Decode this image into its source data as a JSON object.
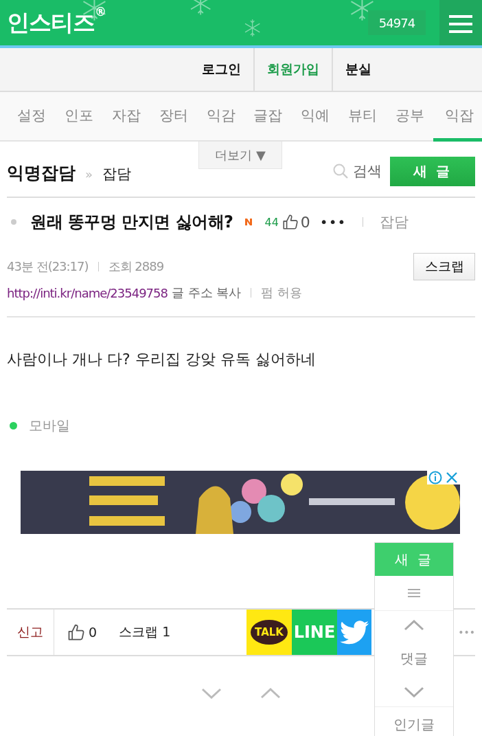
{
  "header": {
    "logo": "인스티즈",
    "logo_mark": "®",
    "counter": "54974"
  },
  "account_links": [
    {
      "label": "로그인",
      "highlighted": false
    },
    {
      "label": "회원가입",
      "highlighted": true
    },
    {
      "label": "분실",
      "highlighted": false
    }
  ],
  "category_tabs": [
    {
      "label": "설정",
      "selected": false
    },
    {
      "label": "인포",
      "selected": false
    },
    {
      "label": "자잡",
      "selected": false
    },
    {
      "label": "장터",
      "selected": false
    },
    {
      "label": "익감",
      "selected": false
    },
    {
      "label": "글잡",
      "selected": false
    },
    {
      "label": "익예",
      "selected": false
    },
    {
      "label": "뷰티",
      "selected": false
    },
    {
      "label": "공부",
      "selected": false
    },
    {
      "label": "익잡",
      "selected": true
    }
  ],
  "board": {
    "title": "익명잡담",
    "separator": "»",
    "subcategory": "잡담",
    "more_label": "더보기",
    "more_arrow": "▼",
    "search_label": "검색",
    "new_post_button": "새 글"
  },
  "post": {
    "title": "원래 똥꾸멍 만지면 싫어해?",
    "comment_count": "44",
    "likes": "0",
    "menu": "•••",
    "category": "잡담",
    "time": "43분 전(23:17)",
    "views": "조회 2889",
    "scrap_button": "스크랩",
    "url": "http://inti.kr/name/23549758",
    "copy_link": "글 주소 복사",
    "permission": "펌 허용",
    "body": "사람이나 개나 다? 우리집 강앚 유독 싫어하네",
    "source": "모바일"
  },
  "actions": {
    "report": "신고",
    "likes": "0",
    "scrap": "스크랩 1",
    "more": "•••",
    "share": [
      {
        "kind": "kakao",
        "label": "TALK"
      },
      {
        "kind": "line",
        "label": "LINE"
      },
      {
        "kind": "twitter"
      }
    ]
  },
  "side_panel": {
    "new_post": "새 글",
    "comments": "댓글",
    "popular": "인기글"
  }
}
